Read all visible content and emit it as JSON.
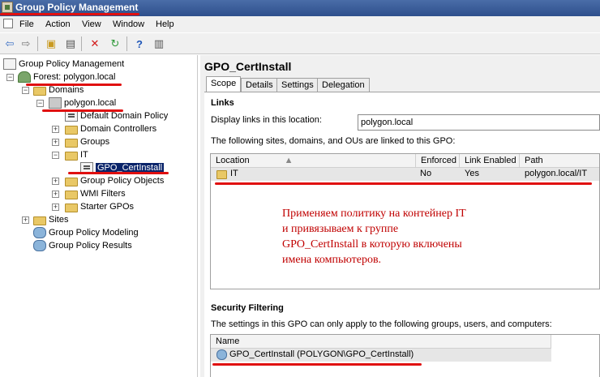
{
  "window": {
    "title": "Group Policy Management"
  },
  "menu": {
    "items": [
      "File",
      "Action",
      "View",
      "Window",
      "Help"
    ]
  },
  "toolbar": {
    "buttons": [
      "back-icon",
      "forward-icon",
      "up-folder-icon",
      "properties-icon",
      "delete-icon",
      "refresh-icon",
      "help-icon",
      "view-icon"
    ]
  },
  "tree": {
    "root": "Group Policy Management",
    "forest": "Forest: polygon.local",
    "domains": "Domains",
    "domain": "polygon.local",
    "default_policy": "Default Domain Policy",
    "domain_controllers": "Domain Controllers",
    "groups": "Groups",
    "it": "IT",
    "gpo_link": "GPO_CertInstall",
    "gp_objects": "Group Policy Objects",
    "wmi": "WMI Filters",
    "starter": "Starter GPOs",
    "sites": "Sites",
    "modeling": "Group Policy Modeling",
    "results": "Group Policy Results"
  },
  "pane": {
    "title": "GPO_CertInstall",
    "tabs": [
      "Scope",
      "Details",
      "Settings",
      "Delegation"
    ],
    "links_heading": "Links",
    "display_links_label": "Display links in this location:",
    "display_links_value": "polygon.local",
    "links_note": "The following sites, domains, and OUs are linked to this GPO:",
    "links_columns": [
      "Location",
      "Enforced",
      "Link Enabled",
      "Path"
    ],
    "links_row": {
      "location": "IT",
      "enforced": "No",
      "link_enabled": "Yes",
      "path": "polygon.local/IT"
    },
    "security_heading": "Security Filtering",
    "security_note": "The settings in this GPO can only apply to the following groups, users, and computers:",
    "security_column": "Name",
    "security_row": "GPO_CertInstall (POLYGON\\GPO_CertInstall)"
  },
  "annotation": [
    "Применяем политику на контейнер IT",
    "и привязываем к группе",
    "GPO_CertInstall в которую включены",
    "имена компьютеров."
  ],
  "colors": {
    "annotation": "#c00000",
    "underline": "#e01010",
    "selection": "#0a246a"
  }
}
